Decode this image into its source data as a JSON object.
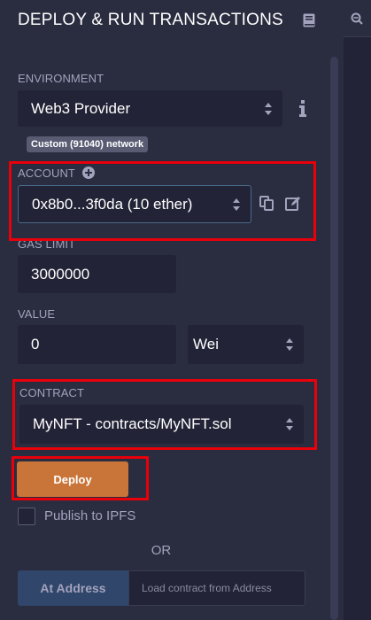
{
  "header": {
    "title": "DEPLOY & RUN TRANSACTIONS"
  },
  "environment": {
    "label": "ENVIRONMENT",
    "selected": "Web3 Provider",
    "network_badge": "Custom (91040) network"
  },
  "account": {
    "label": "ACCOUNT",
    "selected": "0x8b0...3f0da (10 ether)"
  },
  "gas_limit": {
    "label": "GAS LIMIT",
    "value": "3000000"
  },
  "value": {
    "label": "VALUE",
    "amount": "0",
    "unit": "Wei"
  },
  "contract": {
    "label": "CONTRACT",
    "selected": "MyNFT - contracts/MyNFT.sol"
  },
  "actions": {
    "deploy_label": "Deploy",
    "publish_label": "Publish to IPFS",
    "or_label": "OR",
    "at_address_label": "At Address",
    "address_placeholder": "Load contract from Address"
  },
  "colors": {
    "panel_bg": "#2a2c3f",
    "input_bg": "#222336",
    "deploy": "#c97539",
    "at_address": "#30466a",
    "highlight": "#e8000b"
  }
}
